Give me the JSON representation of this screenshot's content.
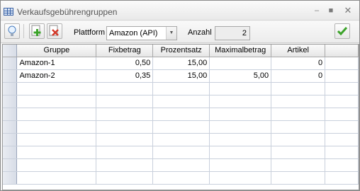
{
  "window": {
    "title": "Verkaufsgebührengruppen"
  },
  "toolbar": {
    "platform_label": "Plattform",
    "platform_value": "Amazon (API)",
    "count_label": "Anzahl",
    "count_value": "2"
  },
  "table": {
    "columns": [
      "Gruppe",
      "Fixbetrag",
      "Prozentsatz",
      "Maximalbetrag",
      "Artikel",
      ""
    ],
    "rows": [
      [
        "Amazon-1",
        "0,50",
        "15,00",
        "",
        "0",
        ""
      ],
      [
        "Amazon-2",
        "0,35",
        "15,00",
        "5,00",
        "0",
        ""
      ]
    ],
    "empty_rows": 8
  },
  "icons": {
    "help": "lightbulb-icon",
    "add": "add-icon",
    "delete": "delete-icon",
    "confirm": "checkmark-icon"
  },
  "colors": {
    "accent_green": "#3ca32a",
    "delete_red": "#d43a2a",
    "window_icon": "#3b63a6"
  }
}
